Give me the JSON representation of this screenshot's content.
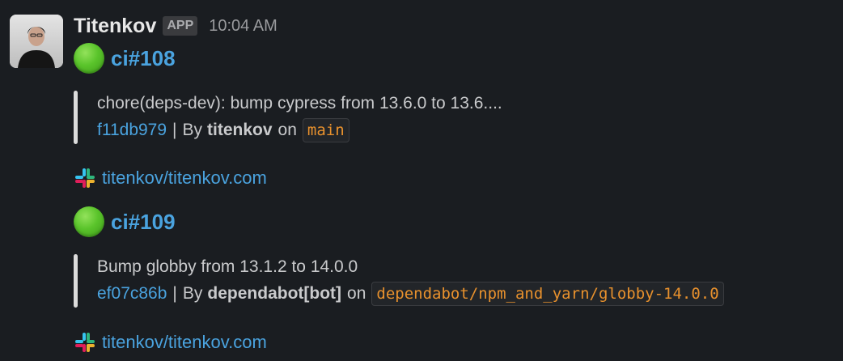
{
  "message": {
    "sender": "Titenkov",
    "badge": "APP",
    "time": "10:04 AM"
  },
  "builds": [
    {
      "status_icon": "green-circle-icon",
      "title": "ci#108",
      "commit_message": "chore(deps-dev): bump cypress from 13.6.0 to 13.6....",
      "sha": "f11db979",
      "separator": "|",
      "by_label": "By",
      "author": "titenkov",
      "on_label": "on",
      "branch": "main",
      "repo": "titenkov/titenkov.com",
      "repo_icon": "slack-icon"
    },
    {
      "status_icon": "green-circle-icon",
      "title": "ci#109",
      "commit_message": "Bump globby from 13.1.2 to 14.0.0",
      "sha": "ef07c86b",
      "separator": "|",
      "by_label": "By",
      "author": "dependabot[bot]",
      "on_label": "on",
      "branch": "dependabot/npm_and_yarn/globby-14.0.0",
      "repo": "titenkov/titenkov.com",
      "repo_icon": "slack-icon"
    }
  ],
  "colors": {
    "background": "#1a1d21",
    "link": "#4aa3df",
    "branch_text": "#e8912d",
    "status_green": "#5ac42b"
  }
}
